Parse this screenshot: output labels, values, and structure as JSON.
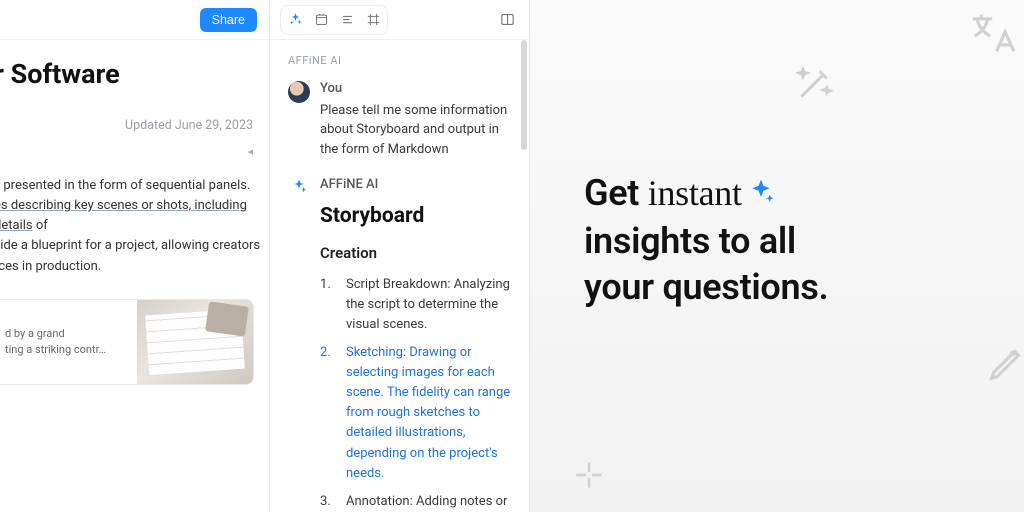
{
  "doc": {
    "title_fragment": "r Software",
    "share_label": "Share",
    "updated_label": "Updated June 29, 2023",
    "paragraph_line1": "y presented in the form of sequential panels.",
    "paragraph_line2": "es describing key scenes or shots, including details",
    "paragraph_line2_tail": " of",
    "paragraph_line3": "vide a blueprint for a project, allowing creators",
    "paragraph_line4": "rces in production.",
    "card_line1": "d by a grand",
    "card_line2": "ting a striking contr…"
  },
  "ai": {
    "header_label": "AFFiNE AI",
    "user_name": "You",
    "user_msg": "Please tell me some information about Storyboard and output in the form of Markdown",
    "ai_name": "AFFiNE AI",
    "response_title": "Storyboard",
    "response_sub": "Creation",
    "list": [
      "Script Breakdown: Analyzing the script to determine the visual scenes.",
      "Sketching: Drawing or selecting images for each scene. The fidelity can range from rough sketches to detailed illustrations, depending on the project's needs.",
      "Annotation: Adding notes or"
    ]
  },
  "promo": {
    "line1_pre": "Get ",
    "line1_em": "instant",
    "line2": "insights to all",
    "line3": "your questions."
  },
  "colors": {
    "accent": "#1e88ff",
    "link": "#1e73d6"
  }
}
